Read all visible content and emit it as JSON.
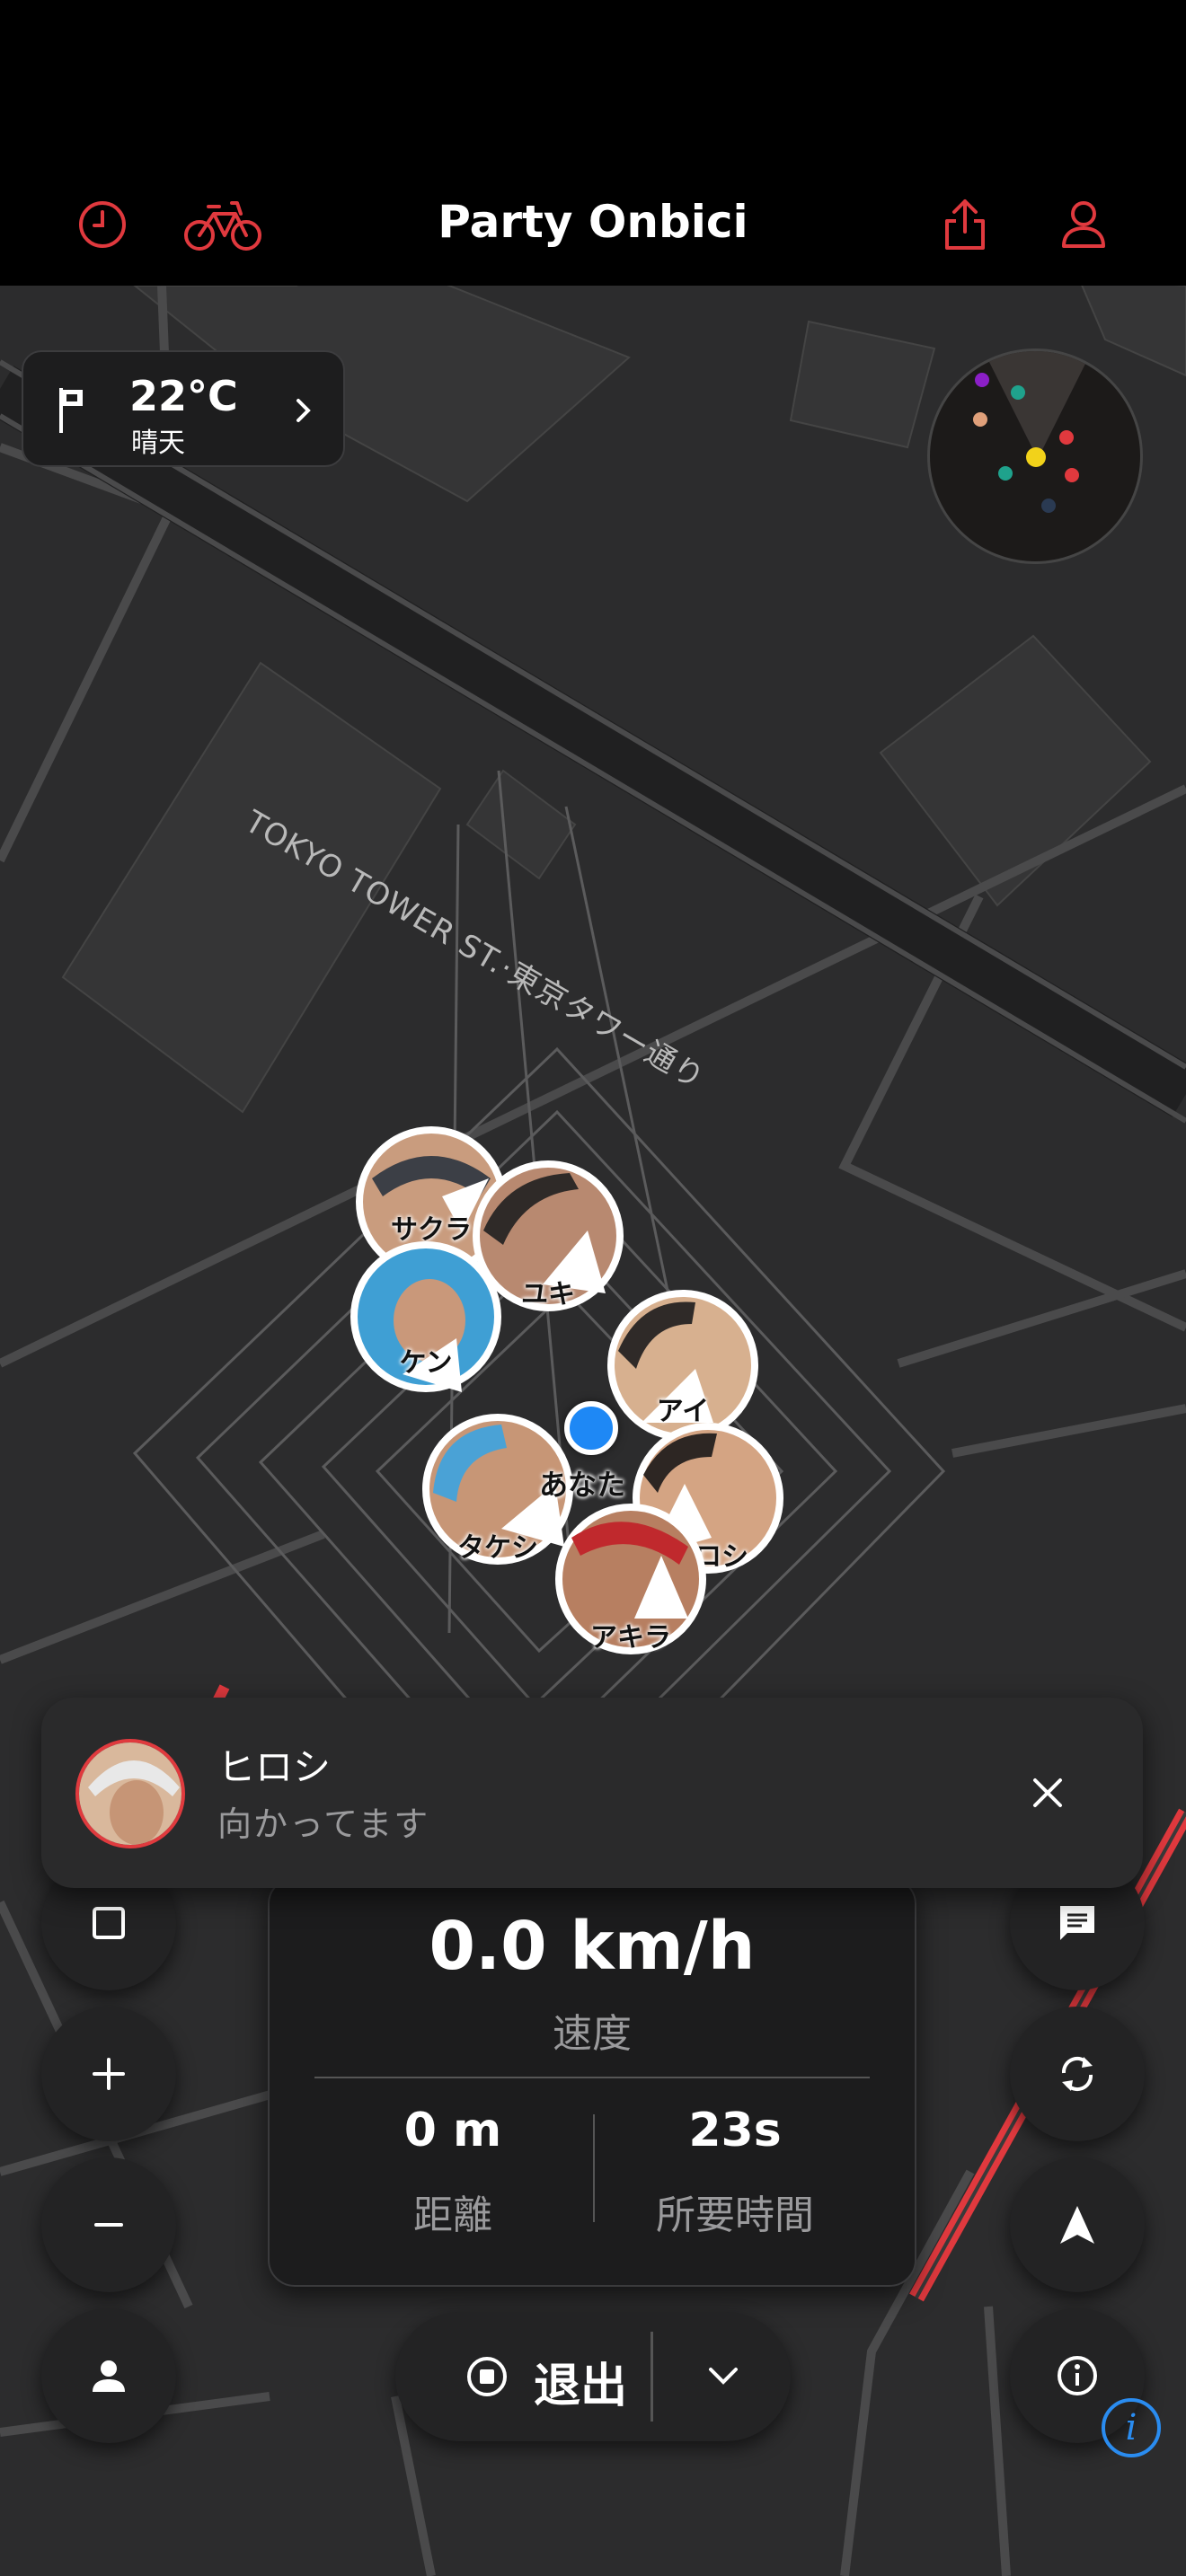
{
  "app": {
    "title": "Party Onbici",
    "brand_color": "#e0393e",
    "icons": [
      "history-clock-icon",
      "bicycle-icon",
      "share-icon",
      "profile-icon"
    ]
  },
  "weather": {
    "temperature": "22°C",
    "condition": "晴天",
    "icons": [
      "flag-icon",
      "chevron-right-icon"
    ]
  },
  "map": {
    "street_label": "TOKYO TOWER ST.·東京タワー通り",
    "route_color": "#e0393e"
  },
  "riders": [
    {
      "name": "サクラ",
      "arrow": "heading-arrow"
    },
    {
      "name": "ユキ",
      "arrow": "heading-arrow"
    },
    {
      "name": "ケン",
      "arrow": "heading-arrow"
    },
    {
      "name": "アイ",
      "arrow": "heading-arrow"
    },
    {
      "name": "タケシ",
      "arrow": "heading-arrow"
    },
    {
      "name": "ヒロシ",
      "arrow": "heading-arrow"
    },
    {
      "name": "アキラ",
      "arrow": "heading-arrow"
    }
  ],
  "you": {
    "label": "あなた",
    "color": "#1e88f5"
  },
  "notification": {
    "name": "ヒロシ",
    "message": "向かってます",
    "close_icon": "close-icon"
  },
  "stats": {
    "speed": "0.0 km/h",
    "speed_label": "速度",
    "distance": "0 m",
    "distance_label": "距離",
    "time": "23s",
    "time_label": "所要時間"
  },
  "controls": {
    "left": [
      "square-stop-icon",
      "zoom-in-icon",
      "zoom-out-icon",
      "person-icon"
    ],
    "right": [
      "chat-icon",
      "sync-icon",
      "navigate-arrow-icon",
      "info-icon"
    ]
  },
  "exit": {
    "label": "退出",
    "icons": [
      "stop-circle-icon",
      "chevron-down-icon"
    ]
  }
}
